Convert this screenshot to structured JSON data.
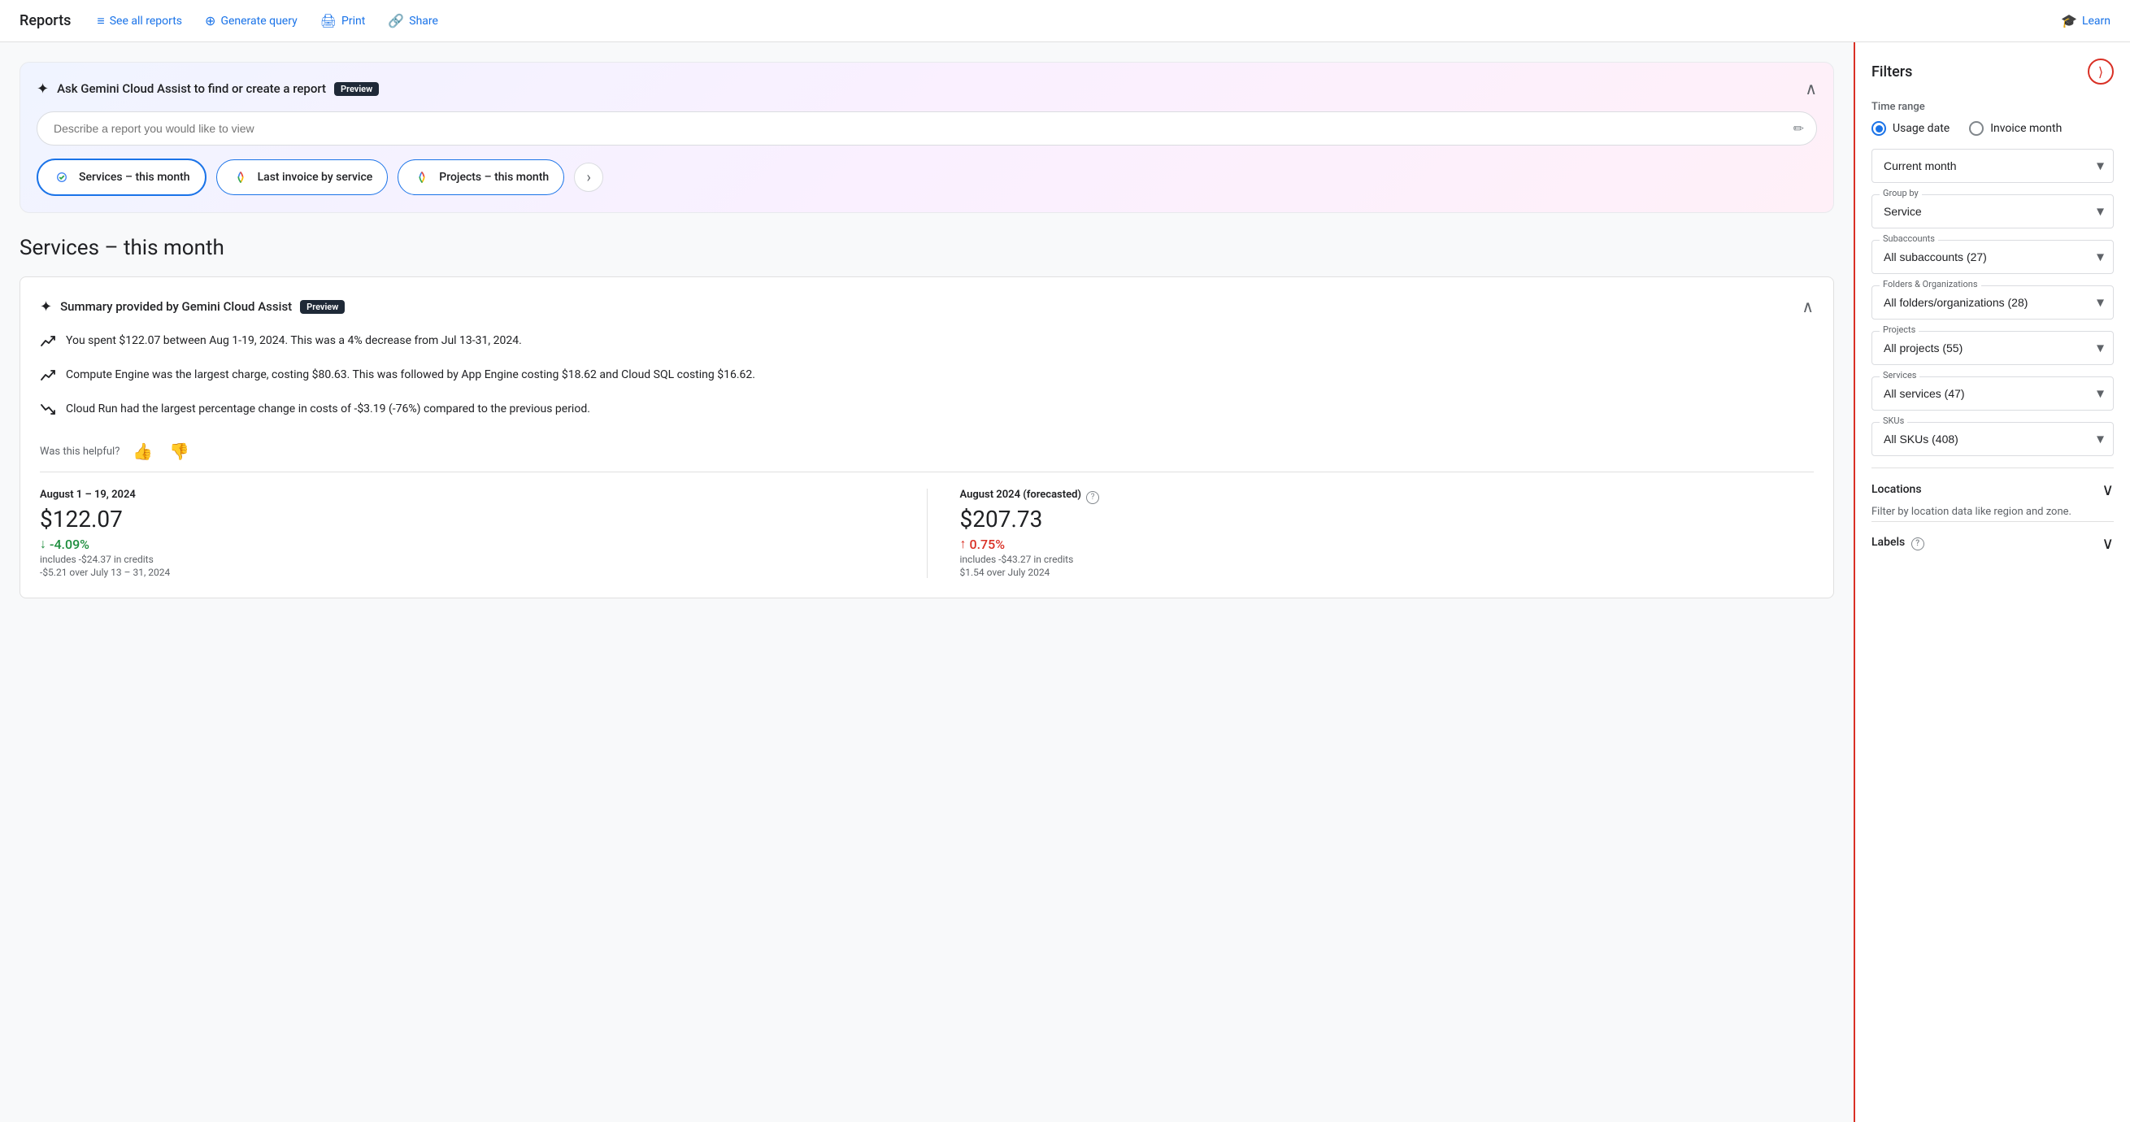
{
  "app": {
    "title": "Reports"
  },
  "topnav": {
    "title": "Reports",
    "links": [
      {
        "id": "see-all-reports",
        "label": "See all reports",
        "icon": "≡"
      },
      {
        "id": "generate-query",
        "label": "Generate query",
        "icon": "🔍"
      },
      {
        "id": "print",
        "label": "Print",
        "icon": "🖨"
      },
      {
        "id": "share",
        "label": "Share",
        "icon": "🔗"
      },
      {
        "id": "learn",
        "label": "Learn",
        "icon": "🎓"
      }
    ]
  },
  "gemini": {
    "title": "Ask Gemini Cloud Assist to find or create a report",
    "preview_label": "Preview",
    "input_placeholder": "Describe a report you would like to view",
    "chips": [
      {
        "id": "services-this-month",
        "label": "Services – this month",
        "active": true
      },
      {
        "id": "last-invoice-by-service",
        "label": "Last invoice by service",
        "active": false
      },
      {
        "id": "projects-this-month",
        "label": "Projects – this month",
        "active": false
      }
    ],
    "next_button_label": "›"
  },
  "page": {
    "title": "Services – this month"
  },
  "summary": {
    "title": "Summary provided by Gemini Cloud Assist",
    "preview_label": "Preview",
    "items": [
      {
        "text": "You spent $122.07 between Aug 1-19, 2024. This was a 4% decrease from Jul 13-31, 2024."
      },
      {
        "text": "Compute Engine was the largest charge, costing $80.63. This was followed by App Engine costing $18.62 and Cloud SQL costing $16.62."
      },
      {
        "text": "Cloud Run had the largest percentage change in costs of -$3.19 (-76%) compared to the previous period."
      }
    ],
    "helpful_label": "Was this helpful?",
    "thumbs_up": "👍",
    "thumbs_down": "👎"
  },
  "stats": {
    "current": {
      "period": "August 1 – 19, 2024",
      "amount": "$122.07",
      "credits_note": "includes -$24.37 in credits",
      "delta": "-4.09%",
      "delta_direction": "down",
      "delta_note": "-$5.21 over July 13 – 31, 2024"
    },
    "forecasted": {
      "period": "August 2024 (forecasted)",
      "amount": "$207.73",
      "credits_note": "includes -$43.27 in credits",
      "delta": "0.75%",
      "delta_direction": "up",
      "delta_note": "$1.54 over July 2024"
    }
  },
  "filters": {
    "title": "Filters",
    "collapse_icon": "⟩",
    "time_range_label": "Time range",
    "radio_options": [
      {
        "id": "usage-date",
        "label": "Usage date",
        "selected": true
      },
      {
        "id": "invoice-month",
        "label": "Invoice month",
        "selected": false
      }
    ],
    "current_month_label": "Current month",
    "group_by_label": "Group by",
    "group_by_value": "Service",
    "subaccounts_label": "Subaccounts",
    "subaccounts_value": "All subaccounts (27)",
    "folders_label": "Folders & Organizations",
    "folders_value": "All folders/organizations (28)",
    "projects_label": "Projects",
    "projects_value": "All projects (55)",
    "services_label": "Services",
    "services_value": "All services (47)",
    "skus_label": "SKUs",
    "skus_value": "All SKUs (408)",
    "locations_label": "Locations",
    "locations_sub": "Filter by location data like region and zone.",
    "labels_label": "Labels",
    "dropdowns": {
      "current_month": {
        "label": "",
        "value": "Current month"
      },
      "group_by": {
        "label": "Group by",
        "value": "Service"
      },
      "subaccounts": {
        "label": "Subaccounts",
        "value": "All subaccounts (27)"
      },
      "folders": {
        "label": "Folders & Organizations",
        "value": "All folders/organizations (28)"
      },
      "projects": {
        "label": "Projects",
        "value": "All projects (55)"
      },
      "services": {
        "label": "Services",
        "value": "All services (47)"
      },
      "skus": {
        "label": "SKUs",
        "value": "All SKUs (408)"
      }
    }
  }
}
